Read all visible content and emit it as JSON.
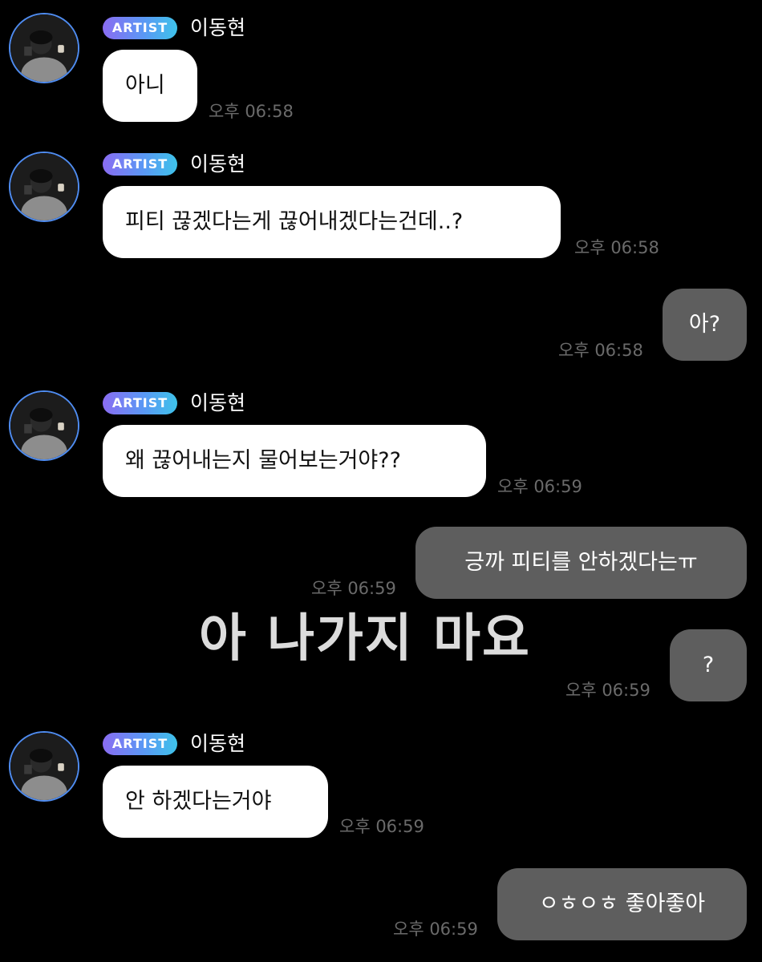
{
  "colors": {
    "background": "#000000",
    "incoming_bubble": "#ffffff",
    "outgoing_bubble": "#5e5e5e",
    "avatar_ring": "#4f8cf0",
    "badge_gradient": [
      "#8a6cf2",
      "#5a98f4",
      "#3ec3ea"
    ],
    "timestamp": "#6a6a6a"
  },
  "sender": {
    "badge": "ARTIST",
    "name": "이동현",
    "avatar_icon": "profile-photo-avatar"
  },
  "messages": [
    {
      "direction": "in",
      "text": "아니",
      "time": "오후 06:58"
    },
    {
      "direction": "in",
      "text": "피티 끊겠다는게 끊어내겠다는건데..?",
      "time": "오후 06:58"
    },
    {
      "direction": "out",
      "text": "아?",
      "time": "오후 06:58"
    },
    {
      "direction": "in",
      "text": "왜 끊어내는지 물어보는거야??",
      "time": "오후 06:59"
    },
    {
      "direction": "out",
      "text": "긍까 피티를 안하겠다는ㅠ",
      "time": "오후 06:59"
    },
    {
      "direction": "out",
      "text": "?",
      "time": "오후 06:59"
    },
    {
      "direction": "in",
      "text": "안 하겠다는거야",
      "time": "오후 06:59"
    },
    {
      "direction": "out",
      "text": "ㅇㅎㅇㅎ 좋아좋아",
      "time": "오후 06:59"
    }
  ],
  "overlay_caption": "아 나가지 마요"
}
